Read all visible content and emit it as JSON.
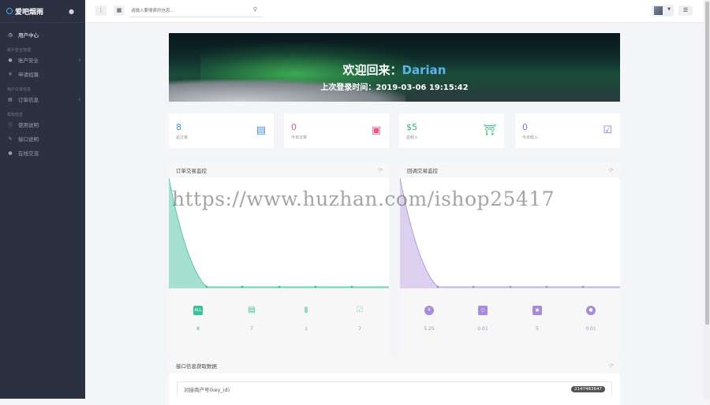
{
  "app": {
    "brand": "爱吧烟雨",
    "brand_icon": "drop-icon"
  },
  "sidebar": {
    "items": [
      {
        "type": "item",
        "label": "用户中心",
        "icon": "gauge-icon",
        "active": true
      },
      {
        "type": "group",
        "label": "账户安全管理"
      },
      {
        "type": "item",
        "label": "账户安全",
        "icon": "user-icon",
        "chevron": true
      },
      {
        "type": "item",
        "label": "申请招募",
        "icon": "yen-icon"
      },
      {
        "type": "group",
        "label": "用户订单信息"
      },
      {
        "type": "item",
        "label": "订单信息",
        "icon": "list-icon",
        "chevron": true
      },
      {
        "type": "group",
        "label": "帮助信息"
      },
      {
        "type": "item",
        "label": "使用说明",
        "icon": "info-icon"
      },
      {
        "type": "item",
        "label": "接口说明",
        "icon": "pencil-icon"
      },
      {
        "type": "item",
        "label": "在线交流",
        "icon": "users-icon"
      }
    ]
  },
  "topbar": {
    "search_placeholder": "请输入要搜索的信息..."
  },
  "banner": {
    "welcome": "欢迎回来：",
    "username": "Darian",
    "last_login_label": "上次登录时间：",
    "last_login_time": "2019-03-06 19:15:42"
  },
  "stats": [
    {
      "value": "8",
      "label": "总订单",
      "icon": "card-icon",
      "color": "#4a90d9"
    },
    {
      "value": "0",
      "label": "今日订单",
      "icon": "calendar-icon",
      "color": "#e9578d"
    },
    {
      "value": "$5",
      "label": "总收入",
      "icon": "bank-icon",
      "color": "#27b46e"
    },
    {
      "value": "0",
      "label": "今日收入",
      "icon": "check-square-icon",
      "color": "#8c6fd0"
    }
  ],
  "panels": {
    "orders": {
      "title": "订单交易监控",
      "color": "#8fd8c4",
      "line_color": "#3cbf9c",
      "items": [
        {
          "icon": "all-icon",
          "icon_text": "ALL",
          "value": "8"
        },
        {
          "icon": "doc-icon",
          "value": "7"
        },
        {
          "icon": "clipboard-icon",
          "value": "1"
        },
        {
          "icon": "clipboard-check-icon",
          "value": "7"
        }
      ]
    },
    "payments": {
      "title": "回调交易监控",
      "color": "#d6c8ec",
      "line_color": "#a58bd8",
      "items": [
        {
          "icon": "yen-circle-icon",
          "value": "5.25"
        },
        {
          "icon": "wechat-icon",
          "value": "0.01"
        },
        {
          "icon": "alipay-icon",
          "value": "5"
        },
        {
          "icon": "qq-icon",
          "value": "0.01"
        }
      ]
    }
  },
  "api_panel": {
    "title": "接口信息获取数据",
    "row_label": "对接商户号(key_id)",
    "row_value": "2147483647"
  },
  "watermark": "https://www.huzhan.com/ishop25417"
}
